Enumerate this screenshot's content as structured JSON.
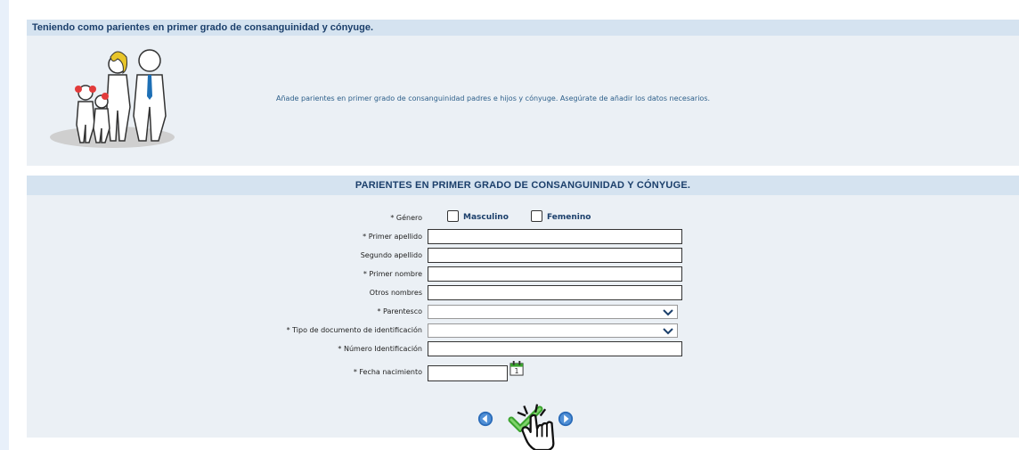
{
  "header": {
    "title": "Teniendo como parientes en primer grado de consanguinidad y cónyuge."
  },
  "intro": {
    "description": "Añade parientes en primer grado de consanguinidad padres e hijos y cónyuge. Asegúrate de añadir los datos necesarios."
  },
  "section": {
    "title": "PARIENTES EN PRIMER GRADO DE CONSANGUINIDAD Y CÓNYUGE."
  },
  "form": {
    "genero_label": "* Género",
    "genero_options": [
      "Masculino",
      "Femenino"
    ],
    "primer_apellido_label": "* Primer apellido",
    "primer_apellido_value": "",
    "segundo_apellido_label": "Segundo apellido",
    "segundo_apellido_value": "",
    "primer_nombre_label": "* Primer nombre",
    "primer_nombre_value": "",
    "otros_nombres_label": "Otros nombres",
    "otros_nombres_value": "",
    "parentesco_label": "* Parentesco",
    "parentesco_value": "",
    "tipo_documento_label": "* Tipo de documento de identificación",
    "tipo_documento_value": "",
    "numero_identificacion_label": "* Número Identificación",
    "numero_identificacion_value": "",
    "fecha_nacimiento_label": "* Fecha nacimiento",
    "fecha_nacimiento_value": "",
    "calendar_day": "1"
  },
  "icons": {
    "calendar": "calendar-icon",
    "back": "back-arrow-icon",
    "confirm": "checkmark-icon",
    "forward": "forward-arrow-icon",
    "pointer": "hand-pointer-icon"
  },
  "colors": {
    "header_bg": "#d5e3f0",
    "panel_bg": "#ebf0f5",
    "title_text": "#1b3f6b",
    "accent_green": "#3aa32e",
    "accent_blue": "#2a6bb8"
  }
}
